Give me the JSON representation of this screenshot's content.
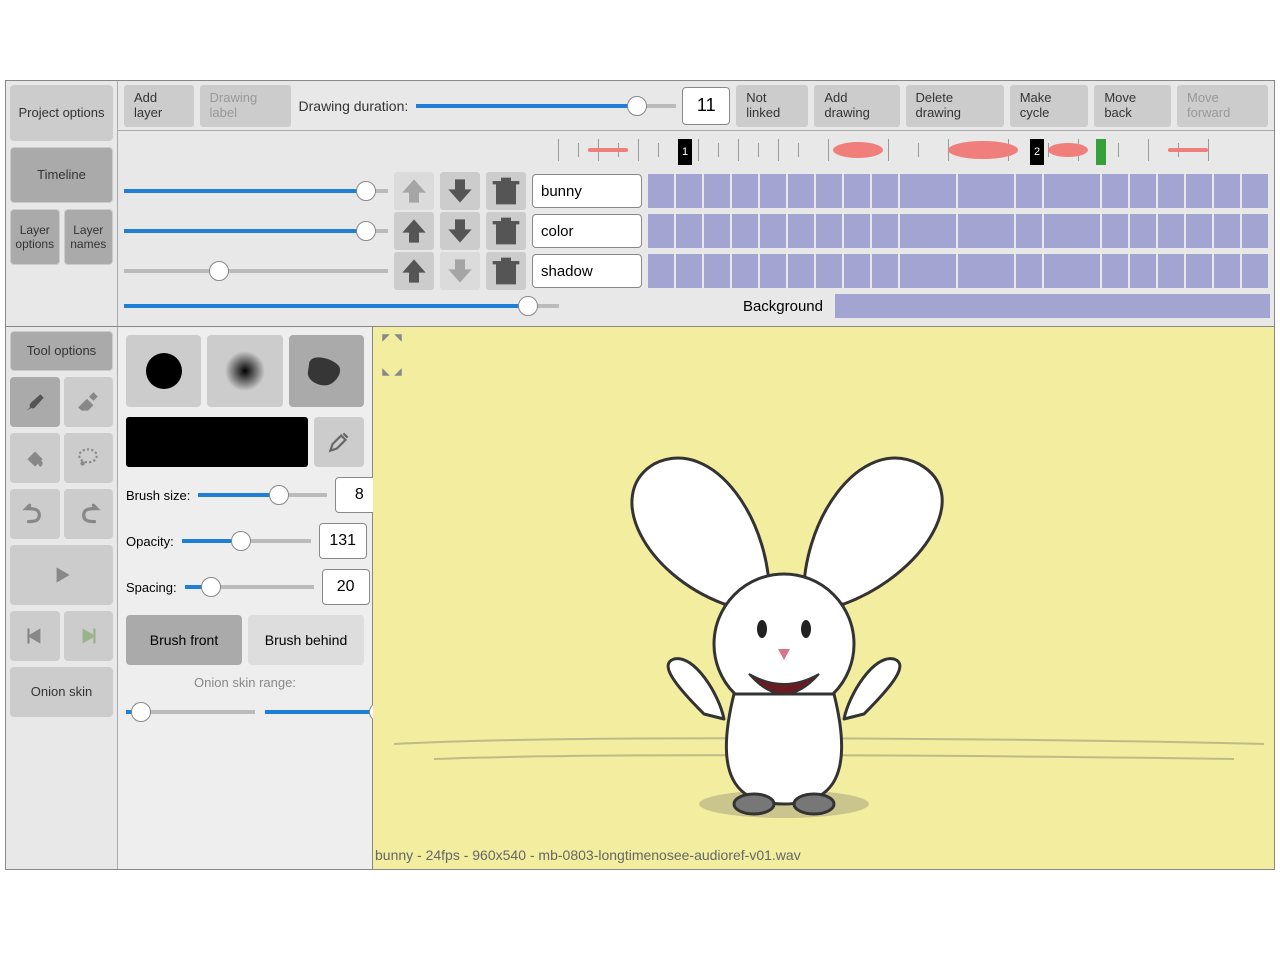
{
  "sidebar": {
    "project_options": "Project options",
    "timeline": "Timeline",
    "layer_options": "Layer options",
    "layer_names": "Layer names",
    "tool_options": "Tool options",
    "onion_skin": "Onion skin"
  },
  "toolbar": {
    "add_layer": "Add layer",
    "drawing_label": "Drawing label",
    "drawing_duration": "Drawing duration:",
    "duration_value": "11",
    "not_linked": "Not linked",
    "add_drawing": "Add drawing",
    "delete_drawing": "Delete drawing",
    "make_cycle": "Make cycle",
    "move_back": "Move back",
    "move_forward": "Move forward"
  },
  "layers": {
    "items": [
      {
        "name": "bunny"
      },
      {
        "name": "color"
      },
      {
        "name": "shadow"
      }
    ],
    "background_label": "Background"
  },
  "timeline_markers": {
    "m1": "1",
    "m2": "2"
  },
  "tool": {
    "brush_size_label": "Brush size:",
    "brush_size": "8",
    "opacity_label": "Opacity:",
    "opacity": "131",
    "spacing_label": "Spacing:",
    "spacing": "20",
    "brush_front": "Brush front",
    "brush_behind": "Brush behind",
    "onion_range": "Onion skin range:"
  },
  "status": "bunny - 24fps - 960x540 - mb-0803-longtimenosee-audioref-v01.wav"
}
